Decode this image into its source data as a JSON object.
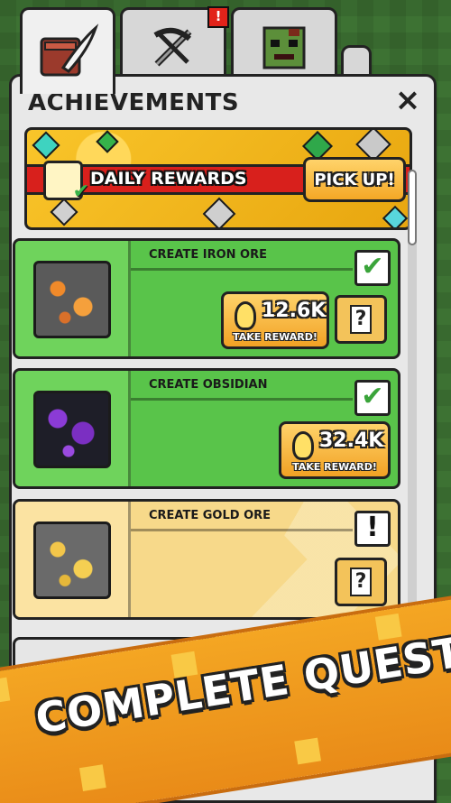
{
  "tabs": [
    {
      "id": "achievements",
      "icon": "book-quill-icon",
      "selected": true
    },
    {
      "id": "tools",
      "icon": "pickaxe-sword-icon",
      "selected": false,
      "alert": "!"
    },
    {
      "id": "zombie",
      "icon": "zombie-face-icon",
      "selected": false
    },
    {
      "id": "more",
      "icon": "tab-icon",
      "selected": false
    }
  ],
  "panel": {
    "title": "ACHIEVEMENTS",
    "close": "×"
  },
  "daily": {
    "label": "DAILY REWARDS",
    "button": "PICK UP!",
    "icon": "calendar-check-icon"
  },
  "quests": [
    {
      "title": "CREATE IRON ORE",
      "status": "✔",
      "amount": "12.6K",
      "action": "TAKE REWARD!",
      "ore": "iron"
    },
    {
      "title": "CREATE OBSIDIAN",
      "status": "✔",
      "amount": "32.4K",
      "action": "TAKE REWARD!",
      "ore": "obsidian"
    },
    {
      "title": "CREATE GOLD ORE",
      "status": "!",
      "ore": "gold"
    }
  ],
  "mystery_label": "?",
  "banner": "COMPLETE QUESTS",
  "colors": {
    "done": "#59c44a",
    "pending": "#f7d98a",
    "accent": "#f4a623",
    "alert": "#e2231a"
  }
}
